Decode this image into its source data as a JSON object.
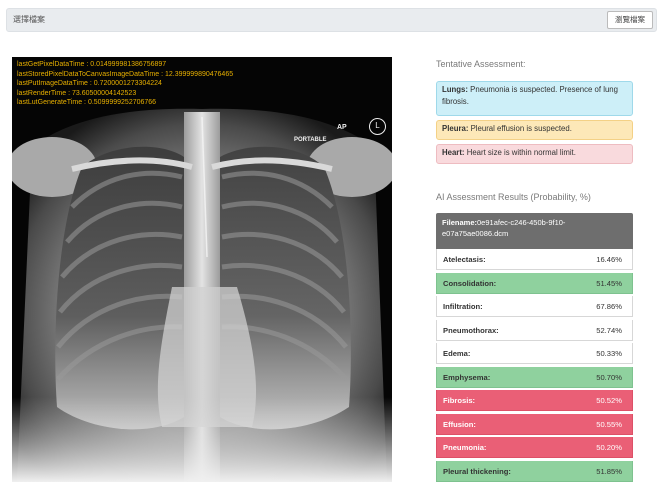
{
  "file_picker": {
    "placeholder": "選擇檔案",
    "browse_label": "瀏覽檔案"
  },
  "viewer": {
    "perf_lines": [
      "lastGetPixelDataTime : 0.014999981386756897",
      "lastStoredPixelDataToCanvasImageDataTime : 12.399999890476465",
      "lastPutImageDataTime : 0.7200001273304224",
      "lastRenderTime : 73.60500004142523",
      "lastLutGenerateTime : 0.5099999252706766"
    ],
    "view_label": "AP",
    "portable_label": "PORTABLE",
    "marker_label": "L"
  },
  "tentative": {
    "title": "Tentative Assessment:",
    "items": [
      {
        "organ": "Lungs:",
        "text": "Pneumonia is suspected. Presence of lung fibrosis.",
        "style": "info"
      },
      {
        "organ": "Pleura:",
        "text": "Pleural effusion is suspected.",
        "style": "warning"
      },
      {
        "organ": "Heart:",
        "text": "Heart size is within normal limit.",
        "style": "danger"
      }
    ]
  },
  "ai_results": {
    "title": "AI Assessment Results (Probability, %)",
    "filename_label": "Filename:",
    "filename_value": "0e91afec-c246-450b-9f10-e07a75ae0086.dcm",
    "rows": [
      {
        "label": "Atelectasis:",
        "value": "16.46%",
        "style": "white"
      },
      {
        "label": "Consolidation:",
        "value": "51.45%",
        "style": "green"
      },
      {
        "label": "Infiltration:",
        "value": "67.86%",
        "style": "white"
      },
      {
        "label": "Pneumothorax:",
        "value": "52.74%",
        "style": "white"
      },
      {
        "label": "Edema:",
        "value": "50.33%",
        "style": "white"
      },
      {
        "label": "Emphysema:",
        "value": "50.70%",
        "style": "green"
      },
      {
        "label": "Fibrosis:",
        "value": "50.52%",
        "style": "red"
      },
      {
        "label": "Effusion:",
        "value": "50.55%",
        "style": "red"
      },
      {
        "label": "Pneumonia:",
        "value": "50.20%",
        "style": "red"
      },
      {
        "label": "Pleural thickening:",
        "value": "51.85%",
        "style": "green"
      }
    ]
  }
}
